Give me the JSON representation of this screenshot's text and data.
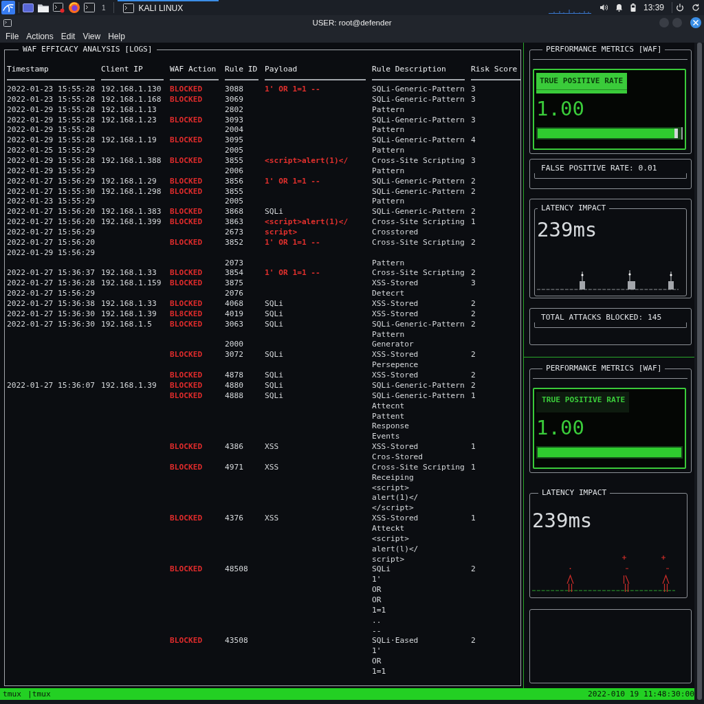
{
  "taskbar": {
    "workspace": "1",
    "task": "KALI LINUX",
    "clock": "13:39"
  },
  "window": {
    "title": "USER: root@defender"
  },
  "menu": [
    "File",
    "Actions",
    "Edit",
    "View",
    "Help"
  ],
  "logs": {
    "title": "WAF EFFICACY ANALYSIS [LOGS]",
    "columns": [
      "Timestamp",
      "Client IP",
      "WAF Action",
      "Rule ID",
      "Payload",
      "Rule Description",
      "Risk Score"
    ],
    "rows": [
      {
        "timestamp": "2022-01-23 15:55:28",
        "client_ip": "192.168.1.130",
        "waf_action": "BLOCKED",
        "rule_id": "3088",
        "payload": {
          "text": "1' OR 1=1 --",
          "flagged": true
        },
        "rule_description": "SQLi-Generic-Pattern",
        "risk_score": "3"
      },
      {
        "timestamp": "2022-01-23 15:55:28",
        "client_ip": "192.168.1.168",
        "waf_action": "BLOCKED",
        "rule_id": "3069",
        "rule_description": "SQLi-Generic-Pattern",
        "risk_score": "3"
      },
      {
        "timestamp": "2022-01-29 15:55:28",
        "client_ip": "192.168.1.13",
        "rule_id": "2802",
        "rule_description": "Pattern"
      },
      {
        "timestamp": "2022-01-29 15:55:28",
        "client_ip": "192.168.1.23",
        "waf_action": "BLOCKED",
        "rule_id": "3093",
        "rule_description": "SQLi-Generic-Pattern",
        "risk_score": "3"
      },
      {
        "timestamp": "2022-01-29 15:55:28",
        "rule_id": "2004",
        "rule_description": "Pattern"
      },
      {
        "timestamp": "2022-01-29 15:55:28",
        "client_ip": "192.168.1.19",
        "waf_action": "BLOCKED",
        "rule_id": "3095",
        "rule_description": "SQLi-Generic-Pattern",
        "risk_score": "4"
      },
      {
        "timestamp": "2022-01-25 15:55:29",
        "rule_id": "2005",
        "rule_description": "Pattern"
      },
      {
        "timestamp": "2022-01-29 15:55:28",
        "client_ip": "192.168.1.388",
        "waf_action": "BLOCKED",
        "rule_id": "3855",
        "payload": {
          "text": "<script>alert(1)</",
          "flagged": true
        },
        "rule_description": "Cross-Site Scripting",
        "risk_score": "3"
      },
      {
        "timestamp": "2022-01-29 15:55:29",
        "rule_id": "2006",
        "rule_description": "Pattern"
      },
      {
        "timestamp": "2022-01-27 15:56:29",
        "client_ip": "192.168.1.29",
        "waf_action": "BLOCKED",
        "rule_id": "3856",
        "payload": {
          "text": "1' OR 1=1 --",
          "flagged": true
        },
        "rule_description": "SQLi-Generic-Pattern",
        "risk_score": "2"
      },
      {
        "timestamp": "2022-01-27 15:55:30",
        "client_ip": "192.168.1.298",
        "waf_action": "BLOCKED",
        "rule_id": "3855",
        "rule_description": "SQLi-Generic-Pattern",
        "risk_score": "2"
      },
      {
        "timestamp": "2022-01-23 15:55:29",
        "rule_id": "2005",
        "rule_description": "Pattern"
      },
      {
        "timestamp": "2022-01-27 15:56:20",
        "client_ip": "192.168.1.383",
        "waf_action": "BLOCKED",
        "rule_id": "3868",
        "payload": {
          "text": "SQLi",
          "flagged": false
        },
        "rule_description": "SQLi-Generic-Pattern",
        "risk_score": "2"
      },
      {
        "timestamp": "2022-01-27 15:56:20",
        "client_ip": "192.168.1.399",
        "waf_action": "BLOCKED",
        "rule_id": "3863",
        "payload": {
          "text": "<script>alert(1)</",
          "flagged": true
        },
        "rule_description": "Cross-Site Scripting",
        "risk_score": "1"
      },
      {
        "timestamp": "2022-01-27 15:56:29",
        "rule_id": "2673",
        "payload": {
          "text": "script>",
          "flagged": true
        },
        "rule_description": "Crosstored"
      },
      {
        "timestamp": "2022-01-27 15:56:20",
        "waf_action": "BLOCKED",
        "rule_id": "3852",
        "payload": {
          "text": "1' OR 1=1 --",
          "flagged": true
        },
        "rule_description": "Cross-Site Scripting",
        "risk_score": "2"
      },
      {
        "timestamp": "2022-01-29 15:56:29"
      },
      {
        "rule_id": "2073",
        "rule_description": "Pattern"
      },
      {
        "timestamp": "2022-01-27 15:36:37",
        "client_ip": "192.168.1.33",
        "waf_action": "BLOCKED",
        "rule_id": "3854",
        "payload": {
          "text": "1' OR 1=1 --",
          "flagged": true
        },
        "rule_description": "Cross-Site Scripting",
        "risk_score": "2"
      },
      {
        "timestamp": "2022-01-27 15:36:28",
        "client_ip": "192.168.1.159",
        "waf_action": "BLOCKED",
        "rule_id": "3875",
        "rule_description": "XSS-Stored",
        "risk_score": "3"
      },
      {
        "timestamp": "2022-01-27 15:56:29",
        "rule_id": "2076",
        "rule_description": "Detecrt"
      },
      {
        "timestamp": "2022-01-27 15:36:38",
        "client_ip": "192.168.1.33",
        "waf_action": "BLOCKED",
        "rule_id": "4068",
        "payload": {
          "text": "SQLi",
          "flagged": false
        },
        "rule_description": "XSS-Stored",
        "risk_score": "2"
      },
      {
        "timestamp": "2022-01-27 15:36:30",
        "client_ip": "192.168.1.39",
        "waf_action": "BL8CKED",
        "rule_id": "4019",
        "payload": {
          "text": "SQLi",
          "flagged": false
        },
        "rule_description": "XSS-Stored",
        "risk_score": "2"
      },
      {
        "timestamp": "2022-01-27 15:36:30",
        "client_ip": "192.168.1.5",
        "waf_action": "BLOCKED",
        "rule_id": "3063",
        "payload": {
          "text": "SQLi",
          "flagged": false
        },
        "rule_description": "SQLi-Generic-Pattern",
        "risk_score": "2"
      },
      {
        "rule_description": "Pattern"
      },
      {
        "rule_id": "2000",
        "rule_description": "Generator"
      },
      {
        "waf_action": "BLOCKED",
        "rule_id": "3072",
        "payload": {
          "text": "SQLi",
          "flagged": false
        },
        "rule_description": "XSS-Stored",
        "risk_score": "2"
      },
      {
        "rule_description": "Persepence"
      },
      {
        "waf_action": "BLOCKED",
        "rule_id": "4878",
        "payload": {
          "text": "SQLi",
          "flagged": false
        },
        "rule_description": "XSS-Stored",
        "risk_score": "2"
      },
      {
        "timestamp": "2022-01-27 15:36:07",
        "client_ip": "192.168.1.39",
        "waf_action": "BLOCKED",
        "rule_id": "4880",
        "payload": {
          "text": "SQLi",
          "flagged": false
        },
        "rule_description": "SQLi-Generic-Pattern",
        "risk_score": "2"
      },
      {
        "waf_action": "BLOCKED",
        "rule_id": "4888",
        "payload": {
          "text": "SQLi",
          "flagged": false
        },
        "rule_description": "SQLi-Generic-Pattern",
        "risk_score": "1"
      },
      {
        "rule_description": "Attecnt"
      },
      {
        "rule_description": "Pattent"
      },
      {
        "rule_description": "Response"
      },
      {
        "rule_description": "Events"
      },
      {
        "waf_action": "BLOCKED",
        "rule_id": "4386",
        "payload": {
          "text": "XSS",
          "flagged": false
        },
        "rule_description": "XSS-Stored",
        "risk_score": "1"
      },
      {
        "rule_description": "Cros-Stored"
      },
      {
        "waf_action": "BLOCKED",
        "rule_id": "4971",
        "payload": {
          "text": "XSS",
          "flagged": false
        },
        "rule_description": "Cross-Site Scripting",
        "risk_score": "1"
      },
      {
        "rule_description": "Receiping"
      },
      {
        "rule_description": "<script>"
      },
      {
        "rule_description": "alert(1)</"
      },
      {
        "rule_description": "</script>"
      },
      {
        "waf_action": "BLOCKED",
        "rule_id": "4376",
        "payload": {
          "text": "XSS",
          "flagged": false
        },
        "rule_description": "XSS-Stored",
        "risk_score": "1"
      },
      {
        "rule_description": "Atteckt"
      },
      {
        "rule_description": "<script>"
      },
      {
        "rule_description": "alert(l)</"
      },
      {
        "rule_description": "script>"
      },
      {
        "waf_action": "BLOCKED",
        "rule_id": "48508",
        "rule_description": "SQLi",
        "risk_score": "2"
      },
      {
        "rule_description": "1'"
      },
      {
        "rule_description": "OR"
      },
      {
        "rule_description": "OR"
      },
      {
        "rule_description": "1=1"
      },
      {
        "rule_description": ".."
      },
      {
        "rule_description": "--"
      },
      {
        "waf_action": "BLOCKED",
        "rule_id": "43508",
        "rule_description": "SQLi·Eased",
        "risk_score": "2"
      },
      {
        "rule_description": "1'"
      },
      {
        "rule_description": "OR"
      },
      {
        "rule_description": "1=1"
      }
    ]
  },
  "metric_sections": [
    {
      "boxes": [
        {
          "kind": "rate",
          "title": "PERFORMANCE METRICS [WAF]",
          "label": "TRUE POSITIVE RATE",
          "label_filled": true,
          "value": "1.00",
          "level": 0.96,
          "thumb": true
        },
        {
          "kind": "stat",
          "text": "FALSE POSITIVE RATE: 0.01"
        },
        {
          "kind": "latency",
          "title": "LATENCY IMPACT",
          "value": "239ms",
          "framed": true,
          "chart": {
            "kind": "bars"
          }
        },
        {
          "kind": "stat",
          "text": "TOTAL ATTACKS BLOCKED: 145"
        }
      ]
    },
    {
      "boxes": [
        {
          "kind": "rate",
          "title": "PERFORMANCE METRICS [WAF]",
          "label": "TRUE POSITIVE RATE",
          "label_filled": false,
          "value": "1.00",
          "level": 1,
          "thumb": false
        },
        {
          "kind": "latency",
          "title": "LATENCY IMPACT",
          "value": "239ms",
          "framed": false,
          "chart": {
            "kind": "figures"
          }
        },
        {
          "kind": "blank"
        }
      ]
    }
  ],
  "status_bar": {
    "windows": [
      "tmux",
      "|tmux"
    ],
    "clock": "2022-010 19 11:48:30:00"
  }
}
